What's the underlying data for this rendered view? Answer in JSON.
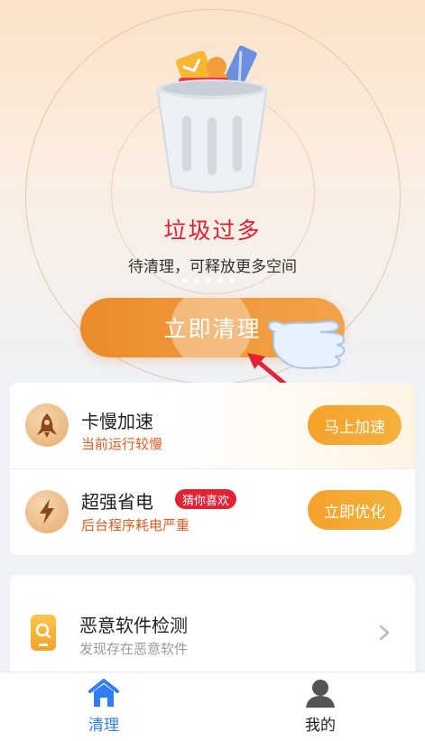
{
  "hero": {
    "title": "垃圾过多",
    "subtitle": "待清理，可释放更多空间",
    "clean_button": "立即清理",
    "carousel_pages": 5,
    "carousel_active": 0
  },
  "features": [
    {
      "title": "卡慢加速",
      "subtitle": "当前运行较慢",
      "button": "马上加速",
      "icon": "rocket-icon"
    },
    {
      "title": "超强省电",
      "tag": "猜你喜欢",
      "subtitle": "后台程序耗电严重",
      "button": "立即优化",
      "icon": "lightning-icon"
    }
  ],
  "malware": {
    "title": "恶意软件检测",
    "subtitle": "发现存在恶意软件",
    "icon": "phone-search-icon"
  },
  "tabbar": {
    "home": "清理",
    "mine": "我的"
  },
  "colors": {
    "accent_orange": "#ee8d2c",
    "alert_red": "#e0202f",
    "subtitle_orange": "#ef5a1e",
    "tab_active": "#2f7ef4"
  }
}
